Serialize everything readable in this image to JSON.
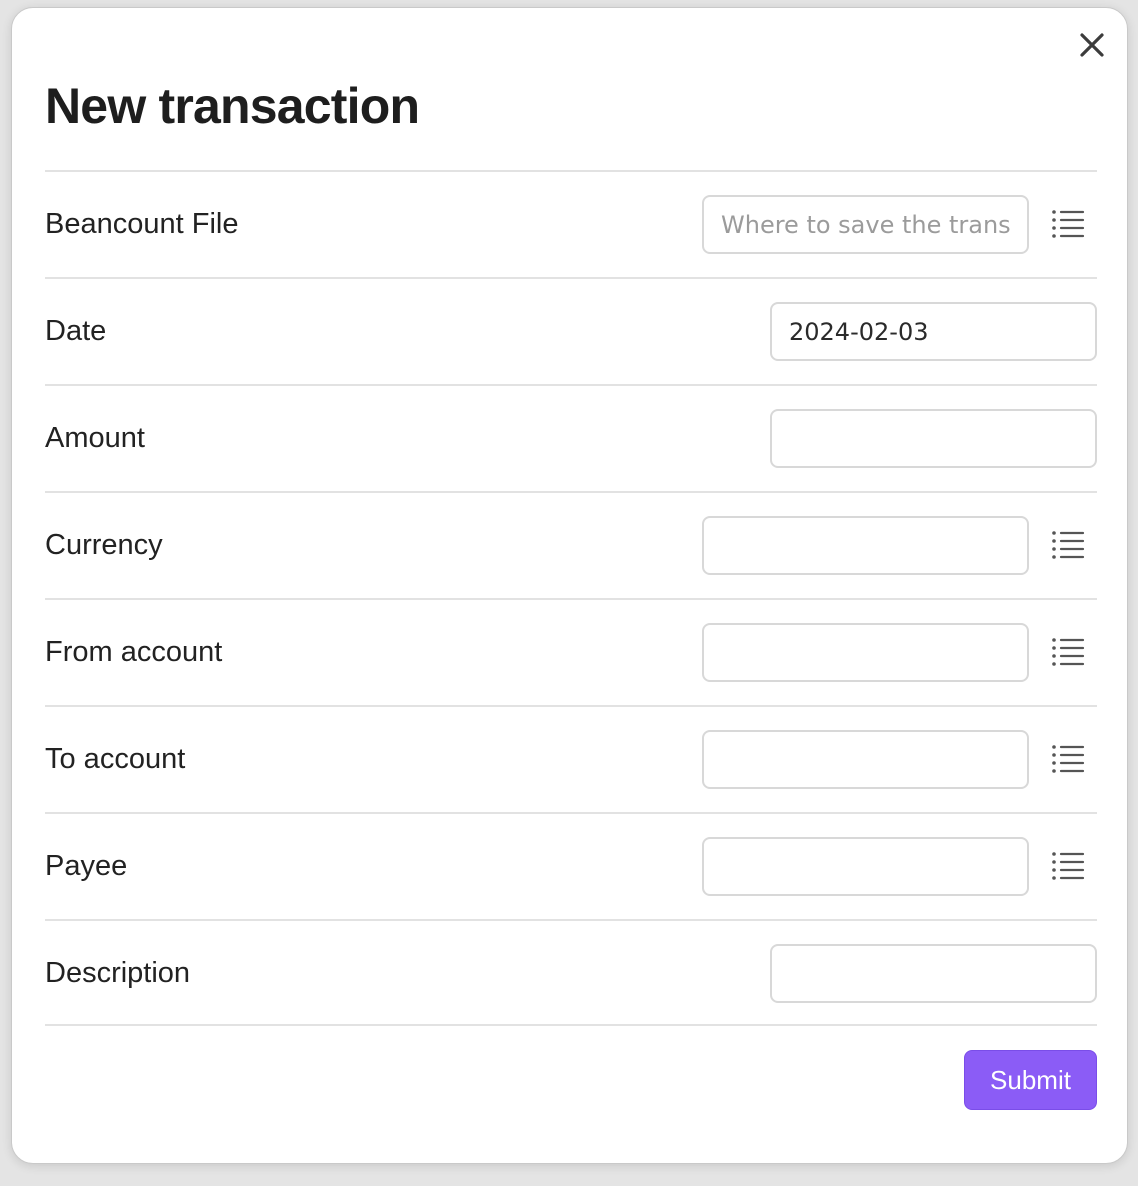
{
  "dialog": {
    "title": "New transaction",
    "close_icon": "close-icon"
  },
  "fields": {
    "beancount_file": {
      "label": "Beancount File",
      "value": "",
      "placeholder": "Where to save the transaction",
      "icon": "list-icon"
    },
    "date": {
      "label": "Date",
      "value": "2024-02-03",
      "placeholder": ""
    },
    "amount": {
      "label": "Amount",
      "value": "",
      "placeholder": ""
    },
    "currency": {
      "label": "Currency",
      "value": "",
      "placeholder": "",
      "icon": "list-icon"
    },
    "from_account": {
      "label": "From account",
      "value": "",
      "placeholder": "",
      "icon": "list-icon"
    },
    "to_account": {
      "label": "To account",
      "value": "",
      "placeholder": "",
      "icon": "list-icon"
    },
    "payee": {
      "label": "Payee",
      "value": "",
      "placeholder": "",
      "icon": "list-icon"
    },
    "description": {
      "label": "Description",
      "value": "",
      "placeholder": ""
    }
  },
  "actions": {
    "submit_label": "Submit"
  },
  "colors": {
    "accent": "#8b5cf6",
    "divider": "#e2e2e2",
    "input_border": "#d8d8d8"
  }
}
